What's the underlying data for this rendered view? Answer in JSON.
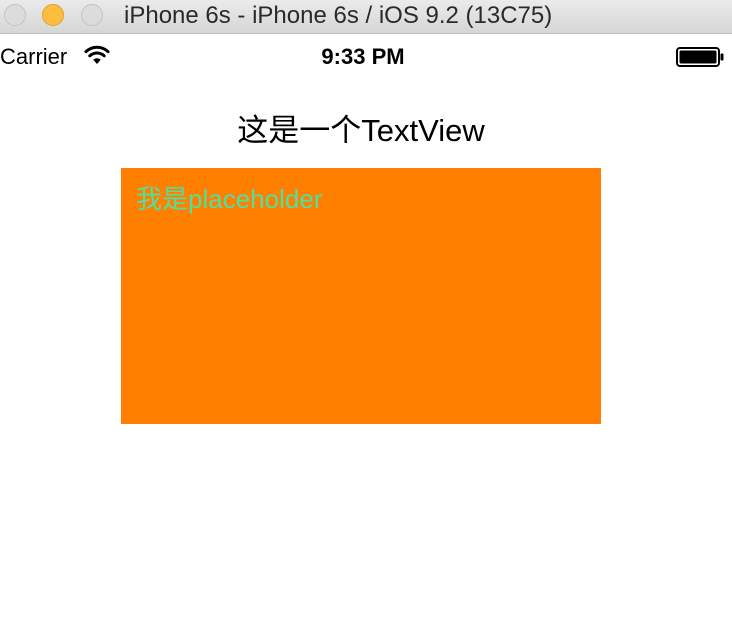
{
  "window": {
    "title": "iPhone 6s - iPhone 6s / iOS 9.2 (13C75)"
  },
  "status_bar": {
    "carrier": "Carrier",
    "time": "9:33 PM",
    "wifi_icon": "wifi-icon",
    "battery_icon": "battery-icon"
  },
  "content": {
    "heading": "这是一个TextView",
    "textview": {
      "placeholder": "我是placeholder",
      "background_color": "#ff8000",
      "placeholder_color": "#4fe0a0"
    }
  }
}
